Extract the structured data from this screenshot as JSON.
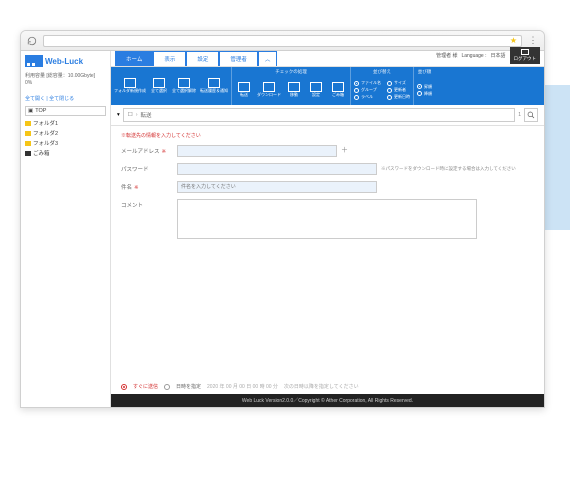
{
  "logo_text": "Web-Luck",
  "status_line1": "利用容量 [総容量：10.00Gbyte]",
  "status_line2": "0%",
  "tree_controls": "全て開く | 全て閉じる",
  "tree": {
    "root": "TOP",
    "items": [
      "フォルダ1",
      "フォルダ2",
      "フォルダ3",
      "ごみ箱"
    ]
  },
  "tabs": [
    "ホーム",
    "表示",
    "設定",
    "管理者"
  ],
  "top_right": {
    "user": "管理者 様",
    "lang_label": "Language :",
    "lang_value": "日本語"
  },
  "logout": "ログアウト",
  "ribbon": {
    "group1": {
      "title": "",
      "items": [
        "フォルダ新規作成",
        "全て選択",
        "全て選択解除",
        "転送履歴＆通知"
      ]
    },
    "group2": {
      "title": "チェックの処理",
      "items": [
        "転送",
        "ダウンロード",
        "移動",
        "設定",
        "ごみ箱"
      ]
    },
    "group3": {
      "title": "並び替え",
      "cols": [
        [
          "ファイル名",
          "グループ",
          "ラベル"
        ],
        [
          "サイズ",
          "更新者",
          "更新日時"
        ]
      ]
    },
    "group4": {
      "title": "並び順",
      "items": [
        "昇順",
        "降順"
      ]
    }
  },
  "crumb": {
    "items": [
      "",
      "転送"
    ],
    "page": "1"
  },
  "form": {
    "note": "※転送先の情報を入力してください",
    "email_label": "メールアドレス",
    "email_value": "",
    "password_label": "パスワード",
    "password_value": "",
    "password_hint": "※パスワードをダウンロード時に設定する場合は入力してください",
    "subject_label": "件名",
    "subject_placeholder": "件名を入力してください",
    "comment_label": "コメント"
  },
  "schedule": {
    "now": "すぐに送信",
    "later": "日時を指定",
    "datetime": "2020 年 00 月 00 日 00 時 00 分",
    "note": "次の日時以降を指定してください"
  },
  "footer": "Web Luck Version2.0.0／Copyright © Ather Corporation, All Rights Reserved."
}
